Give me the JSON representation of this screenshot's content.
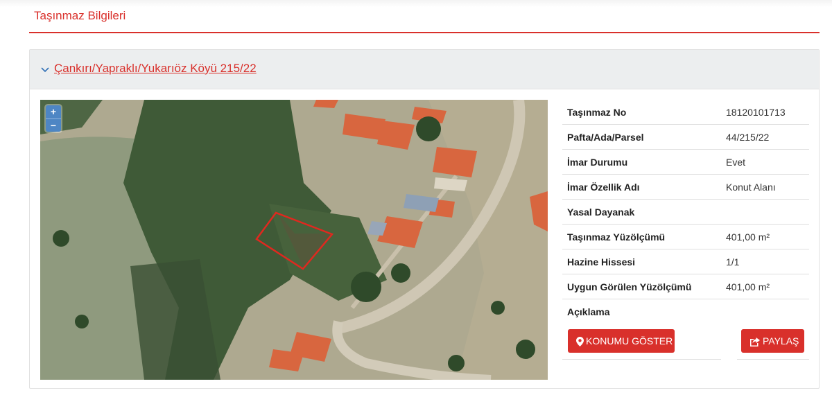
{
  "page": {
    "section_title": "Taşınmaz Bilgileri"
  },
  "card": {
    "title": "Çankırı/Yapraklı/Yukarıöz Köyü 215/22"
  },
  "map": {
    "zoom_in": "+",
    "zoom_out": "−"
  },
  "properties": [
    {
      "label": "Taşınmaz No",
      "value": "18120101713"
    },
    {
      "label": "Pafta/Ada/Parsel",
      "value": "44/215/22"
    },
    {
      "label": "İmar Durumu",
      "value": "Evet"
    },
    {
      "label": "İmar Özellik Adı",
      "value": "Konut Alanı"
    },
    {
      "label": "Yasal Dayanak",
      "value": ""
    },
    {
      "label": "Taşınmaz Yüzölçümü",
      "value": "401,00 m²"
    },
    {
      "label": "Hazine Hissesi",
      "value": "1/1"
    },
    {
      "label": "Uygun Görülen Yüzölçümü",
      "value": "401,00 m²"
    },
    {
      "label": "Açıklama",
      "value": ""
    }
  ],
  "actions": {
    "show_location": "KONUMU GÖSTER",
    "share": "PAYLAŞ"
  },
  "colors": {
    "accent": "#d9302b",
    "header_bg": "#eceeef",
    "zoom": "#4e86c4"
  }
}
